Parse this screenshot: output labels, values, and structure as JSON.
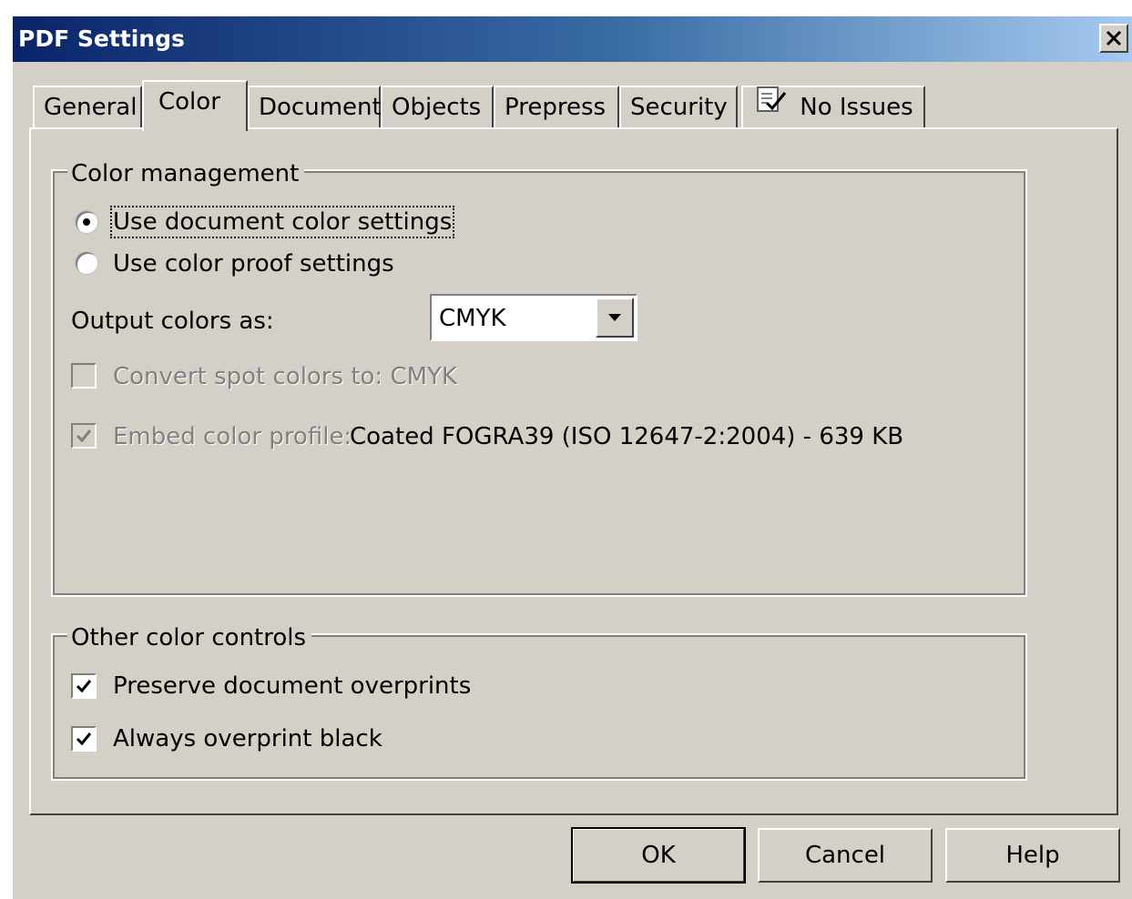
{
  "window": {
    "title": "PDF Settings"
  },
  "tabs": [
    {
      "label": "General"
    },
    {
      "label": "Color",
      "active": true
    },
    {
      "label": "Document"
    },
    {
      "label": "Objects"
    },
    {
      "label": "Prepress"
    },
    {
      "label": "Security"
    },
    {
      "label": "No Issues",
      "icon": "checklist-icon"
    }
  ],
  "color_management": {
    "group_label": "Color management",
    "radio_document": "Use document color settings",
    "radio_proof": "Use color proof settings",
    "selected": "document",
    "output_label": "Output colors as:",
    "output_value": "CMYK",
    "convert_spot_label": "Convert spot colors to: CMYK",
    "convert_spot_checked": false,
    "convert_spot_enabled": false,
    "embed_profile_label": "Embed color profile:",
    "embed_profile_value": "Coated FOGRA39 (ISO 12647-2:2004) - 639 KB",
    "embed_profile_checked": true,
    "embed_profile_enabled": false
  },
  "other_controls": {
    "group_label": "Other color controls",
    "preserve_overprints_label": "Preserve document overprints",
    "preserve_overprints_checked": true,
    "overprint_black_label": "Always overprint black",
    "overprint_black_checked": true
  },
  "buttons": {
    "ok": "OK",
    "cancel": "Cancel",
    "help": "Help"
  },
  "colors": {
    "face": "#d4d0c8",
    "title_start": "#0a246a",
    "title_end": "#a6caf0",
    "disabled_text": "#808080"
  }
}
